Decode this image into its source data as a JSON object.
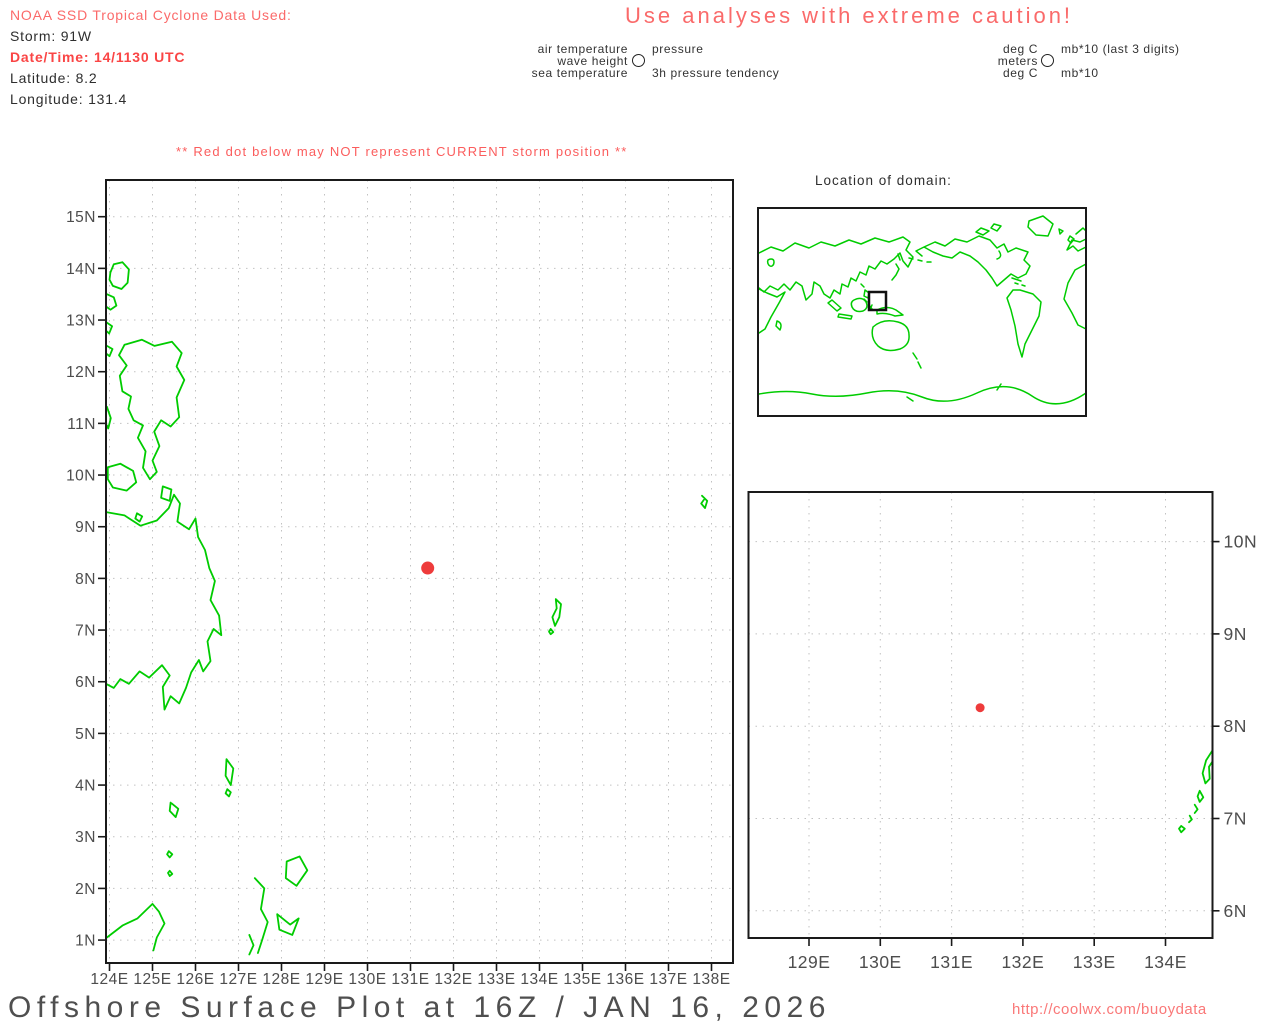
{
  "data_header": {
    "line1": "NOAA SSD Tropical Cyclone Data Used:",
    "storm": "Storm: 91W",
    "datetime": "Date/Time: 14/1130 UTC",
    "latitude": "Latitude: 8.2",
    "longitude": "Longitude: 131.4"
  },
  "caution_title": "Use analyses with extreme caution!",
  "station_legend": {
    "variables": {
      "l1": "air temperature",
      "l2": "wave height",
      "l3": "sea temperature",
      "r1": "pressure",
      "r3": "3h pressure tendency"
    },
    "units": {
      "l1": "deg C",
      "l2": "meters",
      "l3": "deg C",
      "r1": "mb*10 (last 3 digits)",
      "r3": "mb*10"
    }
  },
  "warning": "** Red dot below may NOT represent CURRENT storm position **",
  "domain_map_title": "Location of domain:",
  "main_map": {
    "lat_labels": [
      "15N",
      "14N",
      "13N",
      "12N",
      "11N",
      "10N",
      "9N",
      "8N",
      "7N",
      "6N",
      "5N",
      "4N",
      "3N",
      "2N",
      "1N"
    ],
    "lon_labels": [
      "124E",
      "125E",
      "126E",
      "127E",
      "128E",
      "129E",
      "130E",
      "131E",
      "132E",
      "133E",
      "134E",
      "135E",
      "136E",
      "137E",
      "138E"
    ],
    "storm_dot": {
      "lon": 131.4,
      "lat": 8.2
    }
  },
  "inset_map": {
    "lat_labels": [
      "10N",
      "9N",
      "8N",
      "7N",
      "6N"
    ],
    "lon_labels": [
      "129E",
      "130E",
      "131E",
      "132E",
      "133E",
      "134E"
    ],
    "storm_dot": {
      "lon": 131.4,
      "lat": 8.2
    }
  },
  "footer": {
    "title": "Offshore Surface Plot at 16Z / JAN 16, 2026",
    "url": "http://coolwx.com/buoydata"
  },
  "colors": {
    "coastline": "#00cc00",
    "storm_red": "#ee3b3b",
    "salmon_text": "#fb6a6a",
    "strong_red": "#fa4545",
    "grid": "#c2c2c2"
  }
}
